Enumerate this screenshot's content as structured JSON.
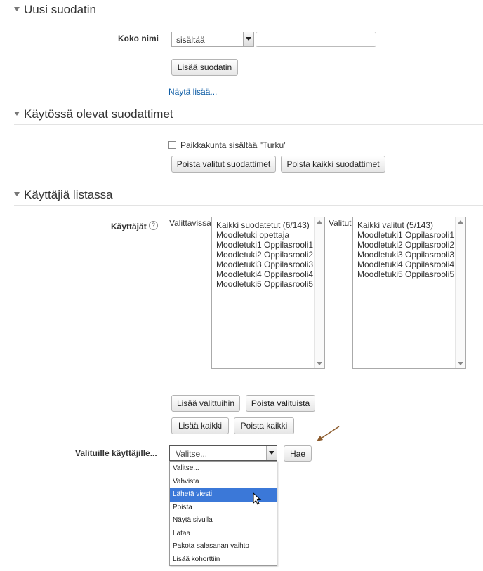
{
  "new_filter": {
    "heading": "Uusi suodatin",
    "full_name_label": "Koko nimi",
    "operator_value": "sisältää",
    "text_value": "",
    "add_filter_button": "Lisää suodatin",
    "show_more_link": "Näytä lisää..."
  },
  "active_filters": {
    "heading": "Käytössä olevat suodattimet",
    "filter_checkbox_label": "Paikkakunta sisältää \"Turku\"",
    "remove_selected_button": "Poista valitut suodattimet",
    "remove_all_button": "Poista kaikki suodattimet"
  },
  "users_in_list": {
    "heading": "Käyttäjiä listassa",
    "users_label": "Käyttäjät",
    "available_label": "Valittavissa",
    "available_items": [
      "Kaikki suodatetut (6/143)",
      "Moodletuki opettaja",
      "Moodletuki1 Oppilasrooli1",
      "Moodletuki2 Oppilasrooli2",
      "Moodletuki3 Oppilasrooli3",
      "Moodletuki4 Oppilasrooli4",
      "Moodletuki5 Oppilasrooli5"
    ],
    "selected_label": "Valitut",
    "selected_items": [
      "Kaikki valitut (5/143)",
      "Moodletuki1 Oppilasrooli1",
      "Moodletuki2 Oppilasrooli2",
      "Moodletuki3 Oppilasrooli3",
      "Moodletuki4 Oppilasrooli4",
      "Moodletuki5 Oppilasrooli5"
    ],
    "add_to_selected_button": "Lisää valittuihin",
    "remove_from_selected_button": "Poista valituista",
    "add_all_button": "Lisää kaikki",
    "remove_all_button": "Poista kaikki"
  },
  "bulk_action": {
    "label": "Valituille käyttäjille...",
    "select_value": "Valitse...",
    "go_button": "Hae",
    "options": [
      "Valitse...",
      "Vahvista",
      "Lähetä viesti",
      "Poista",
      "Näytä sivulla",
      "Lataa",
      "Pakota salasanan vaihto",
      "Lisää kohorttiin"
    ],
    "highlighted_option": "Lähetä viesti"
  },
  "colors": {
    "link": "#0b5ba4",
    "highlight": "#3b78d8",
    "annotation_arrow": "#8b5a2b"
  }
}
